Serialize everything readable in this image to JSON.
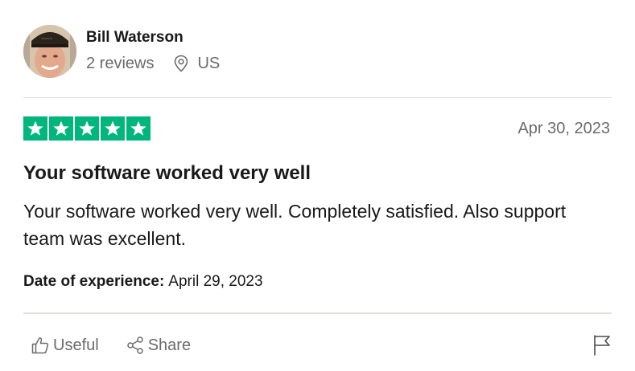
{
  "reviewer": {
    "name": "Bill Waterson",
    "reviews": "2 reviews",
    "location": "US"
  },
  "review": {
    "rating": 5,
    "rating_max": 5,
    "date": "Apr 30, 2023",
    "title": "Your software worked very well",
    "body": "Your software worked very well. Completely satisfied. Also support team was excellent.",
    "experience_label": "Date of experience:",
    "experience_date": "April 29, 2023"
  },
  "actions": {
    "useful_label": "Useful",
    "share_label": "Share"
  },
  "icons": {
    "location": "location-pin-icon",
    "useful": "thumbs-up-icon",
    "share": "share-icon",
    "report": "flag-icon",
    "star": "star-icon"
  },
  "colors": {
    "star_background": "#00b67a",
    "muted_text": "#6b6b6b",
    "primary_text": "#191919"
  }
}
